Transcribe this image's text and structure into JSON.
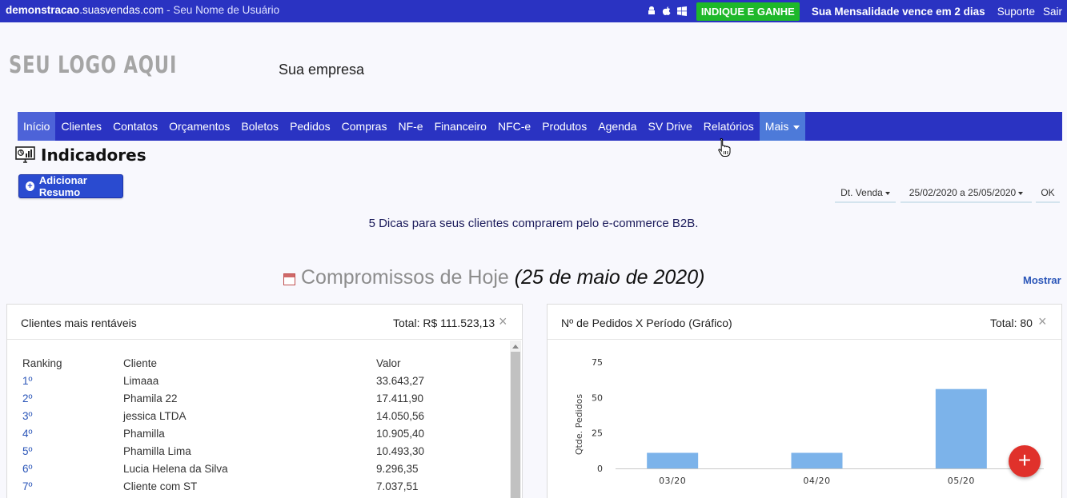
{
  "topbar": {
    "domain": "demonstracao",
    "domain_suffix": ".suasvendas.com",
    "user_text": " - Seu Nome de Usuário",
    "indique_label": "INDIQUE E GANHE",
    "mensalidade_text": "Sua Mensalidade vence em 2 dias",
    "suporte_label": "Suporte",
    "sair_label": "Sair",
    "colors": {
      "bar": "#2a33c2",
      "indique": "#1eb82a"
    }
  },
  "header": {
    "logo_text": "SEU LOGO AQUI",
    "company_name": "Sua empresa"
  },
  "nav": {
    "items": [
      {
        "label": "Início"
      },
      {
        "label": "Clientes"
      },
      {
        "label": "Contatos"
      },
      {
        "label": "Orçamentos"
      },
      {
        "label": "Boletos"
      },
      {
        "label": "Pedidos"
      },
      {
        "label": "Compras"
      },
      {
        "label": "NF-e"
      },
      {
        "label": "Financeiro"
      },
      {
        "label": "NFC-e"
      },
      {
        "label": "Produtos"
      },
      {
        "label": "Agenda"
      },
      {
        "label": "SV Drive"
      },
      {
        "label": "Relatórios"
      }
    ],
    "more_label": "Mais"
  },
  "page": {
    "title": "Indicadores",
    "add_button_label": "Adicionar Resumo",
    "filter_type": "Dt. Venda",
    "filter_range": "25/02/2020 a 25/05/2020",
    "ok_label": "OK",
    "tip_text": "5 Dicas para seus clientes comprarem pelo e-commerce B2B.",
    "compromissos_label": "Compromissos de Hoje ",
    "compromissos_date": "(25 de maio de 2020)",
    "mostrar_label": "Mostrar"
  },
  "clientes_panel": {
    "title": "Clientes mais rentáveis",
    "total": "Total: R$ 111.523,13",
    "close": "×",
    "headers": {
      "ranking": "Ranking",
      "cliente": "Cliente",
      "valor": "Valor"
    },
    "rows": [
      {
        "rank": "1º",
        "cliente": "Limaaa",
        "valor": "33.643,27"
      },
      {
        "rank": "2º",
        "cliente": "Phamila 22",
        "valor": "17.411,90"
      },
      {
        "rank": "3º",
        "cliente": "jessica LTDA",
        "valor": "14.050,56"
      },
      {
        "rank": "4º",
        "cliente": "Phamilla",
        "valor": "10.905,40"
      },
      {
        "rank": "5º",
        "cliente": "Phamilla Lima",
        "valor": "10.493,30"
      },
      {
        "rank": "6º",
        "cliente": "Lucia Helena da Silva",
        "valor": "9.296,35"
      },
      {
        "rank": "7º",
        "cliente": "Cliente com ST",
        "valor": "7.037,51"
      }
    ]
  },
  "pedidos_panel": {
    "title": "Nº de Pedidos X Período (Gráfico)",
    "total": "Total: 80",
    "close": "×"
  },
  "chart_data": {
    "type": "bar",
    "categories": [
      "03/20",
      "04/20",
      "05/20"
    ],
    "values": [
      11,
      11,
      56
    ],
    "ylabel": "Qtde. Pedidos",
    "yticks": [
      0,
      25,
      50,
      75
    ],
    "ylim": [
      0,
      75
    ],
    "bar_color": "#7cb3ea",
    "grid": false
  },
  "fab": {
    "label": "+",
    "color": "#e0312b"
  }
}
